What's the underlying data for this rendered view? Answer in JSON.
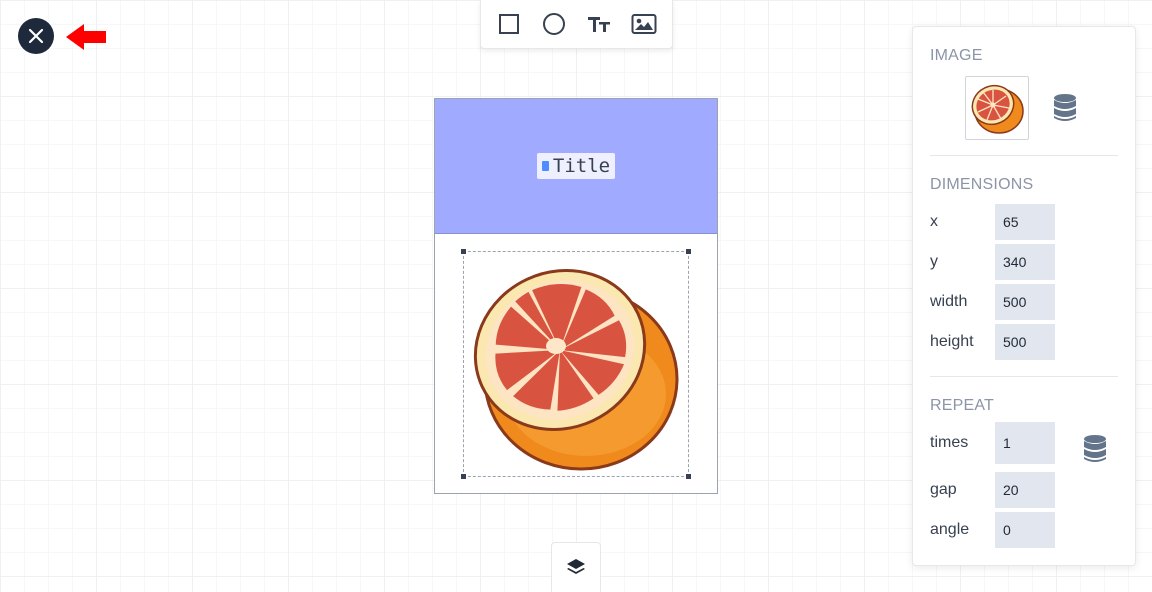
{
  "toolbar": {
    "tools": [
      {
        "name": "rectangle-tool"
      },
      {
        "name": "circle-tool"
      },
      {
        "name": "text-tool",
        "glyph": "Tт"
      },
      {
        "name": "image-tool"
      }
    ]
  },
  "canvas": {
    "header_color": "#a0aaff",
    "title_text": "Title"
  },
  "panel": {
    "image": {
      "section_title": "IMAGE"
    },
    "dimensions": {
      "section_title": "DIMENSIONS",
      "fields": [
        {
          "label": "x",
          "value": "65"
        },
        {
          "label": "y",
          "value": "340"
        },
        {
          "label": "width",
          "value": "500"
        },
        {
          "label": "height",
          "value": "500"
        }
      ]
    },
    "repeat": {
      "section_title": "REPEAT",
      "fields": [
        {
          "label": "times",
          "value": "1"
        },
        {
          "label": "gap",
          "value": "20"
        },
        {
          "label": "angle",
          "value": "0"
        }
      ]
    }
  },
  "colors": {
    "close_button": "#1e293b",
    "arrow": "#ff0000",
    "input_bg": "#e2e6ee",
    "section_title": "#8b95a7"
  }
}
